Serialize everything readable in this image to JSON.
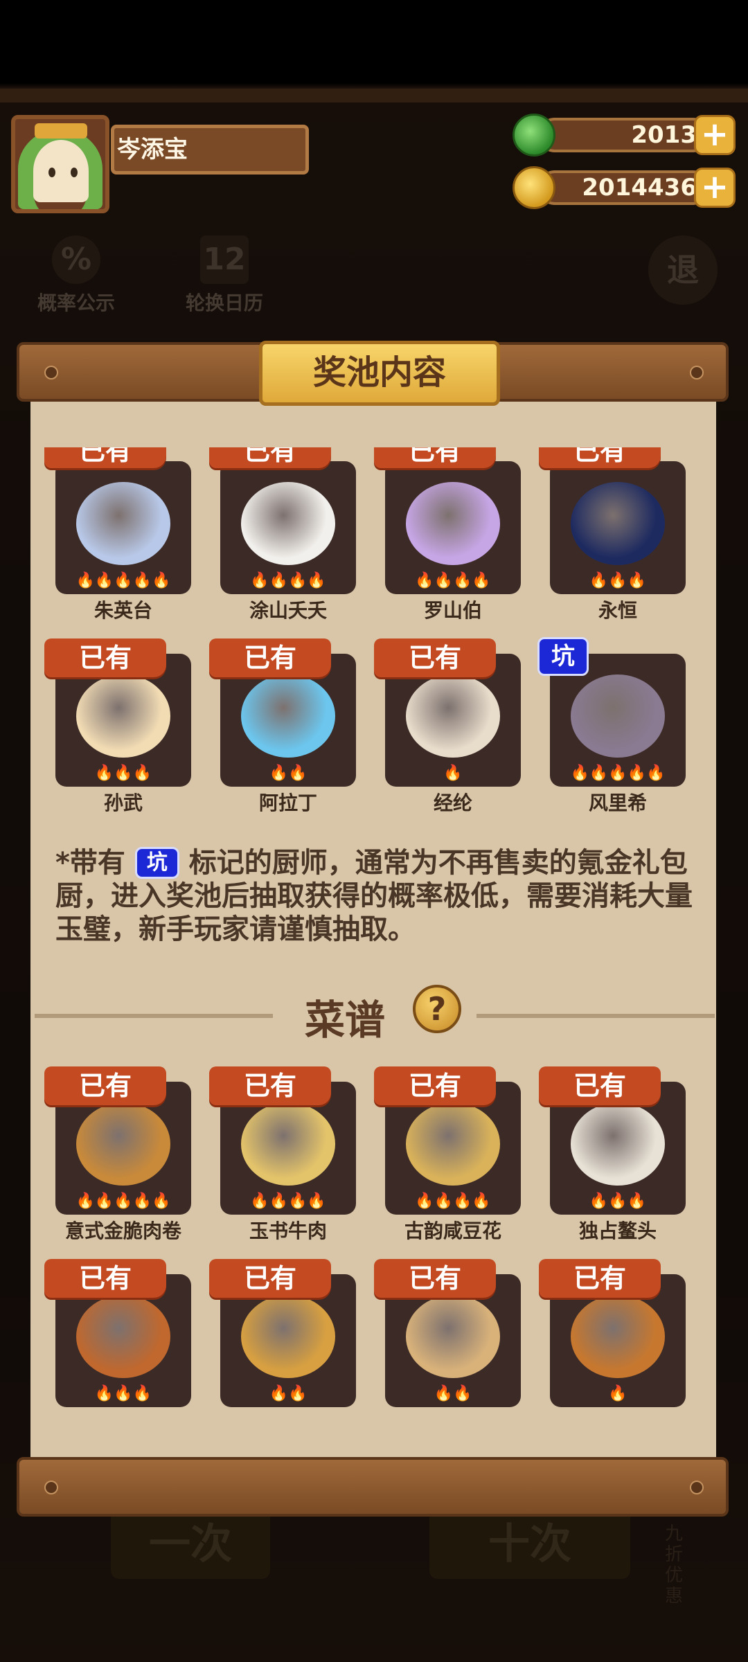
{
  "player": {
    "name": "岑添宝"
  },
  "currencies": {
    "jade": {
      "amount": "2013",
      "plus": "+",
      "icon": "jade-icon"
    },
    "coins": {
      "amount": "2014436",
      "plus": "+",
      "icon": "coin-icon"
    }
  },
  "background": {
    "probability_label": "概率公示",
    "probability_icon_text": "%",
    "calendar_label": "轮换日历",
    "calendar_icon_text": "12",
    "exit_label": "退",
    "bottom_left": "一次",
    "bottom_right": "十次",
    "discount": "九折优惠"
  },
  "dialog": {
    "title": "奖池内容",
    "owned_label": "已有",
    "pit_label": "坑",
    "chefs": [
      {
        "name": "朱英台",
        "stars": 5,
        "owned": true,
        "color": "#b8c8e8"
      },
      {
        "name": "涂山夭夭",
        "stars": 4,
        "owned": true,
        "color": "#f2f0ec"
      },
      {
        "name": "罗山伯",
        "stars": 4,
        "owned": true,
        "color": "#c7a6e6"
      },
      {
        "name": "永恒",
        "stars": 3,
        "owned": true,
        "color": "#1d2a60"
      },
      {
        "name": "孙武",
        "stars": 3,
        "owned": true,
        "color": "#f2dcb4"
      },
      {
        "name": "阿拉丁",
        "stars": 2,
        "owned": true,
        "color": "#6cc6ee"
      },
      {
        "name": "经纶",
        "stars": 1,
        "owned": true,
        "color": "#e8dccb"
      },
      {
        "name": "风里希",
        "stars": 5,
        "owned": false,
        "pit": true,
        "color": "#8a7a92"
      }
    ],
    "note_prefix": "*带有",
    "note_suffix": "标记的厨师，通常为不再售卖的氪金礼包厨，进入奖池后抽取获得的概率极低，需要消耗大量玉璧，新手玩家请谨慎抽取。",
    "recipes_title": "菜谱",
    "help_icon": "?",
    "recipes": [
      {
        "name": "意式金脆肉卷",
        "stars": 5,
        "owned": true,
        "color": "#c98a3a"
      },
      {
        "name": "玉书牛肉",
        "stars": 4,
        "owned": true,
        "color": "#e4c46a"
      },
      {
        "name": "古韵咸豆花",
        "stars": 4,
        "owned": true,
        "color": "#d9b25a"
      },
      {
        "name": "独占鳌头",
        "stars": 3,
        "owned": true,
        "color": "#e8e2d6"
      },
      {
        "name": "",
        "stars": 3,
        "owned": true,
        "color": "#c0682e"
      },
      {
        "name": "",
        "stars": 2,
        "owned": true,
        "color": "#d8a040"
      },
      {
        "name": "",
        "stars": 2,
        "owned": true,
        "color": "#d9b27a"
      },
      {
        "name": "",
        "stars": 1,
        "owned": true,
        "color": "#c8782e"
      }
    ]
  }
}
